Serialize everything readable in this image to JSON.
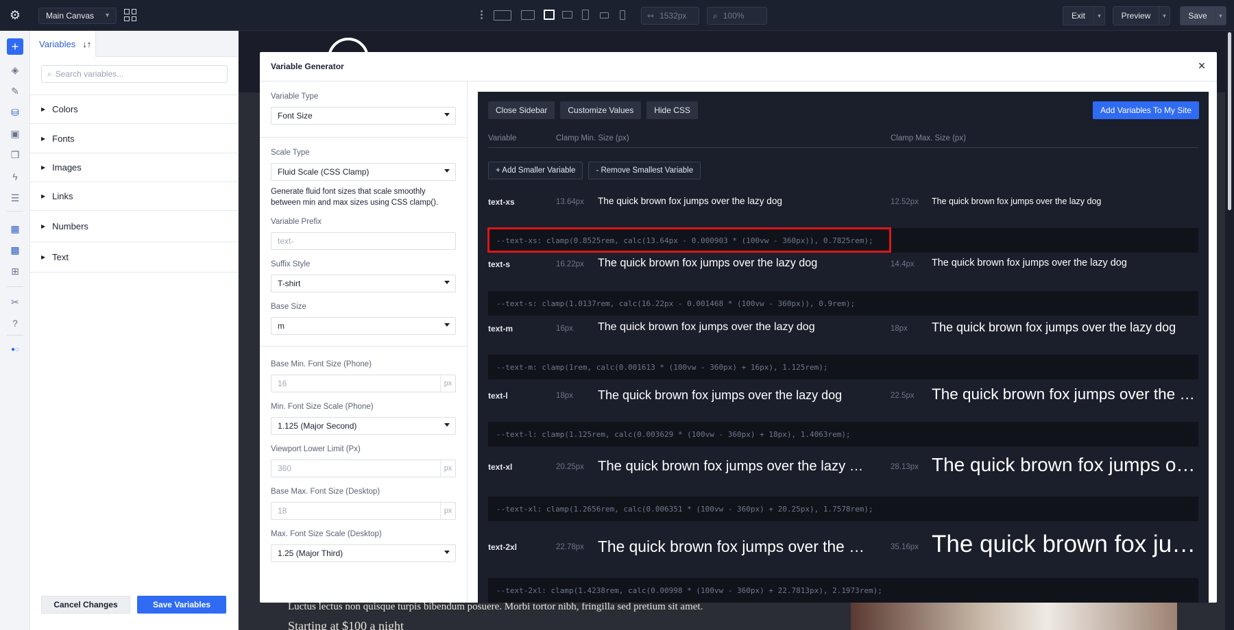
{
  "topbar": {
    "canvas_select": "Main Canvas",
    "width_value": "1532px",
    "zoom_value": "100%",
    "exit_label": "Exit",
    "preview_label": "Preview",
    "save_label": "Save"
  },
  "variables_panel": {
    "tab_label": "Variables",
    "search_placeholder": "Search variables...",
    "groups": [
      "Colors",
      "Fonts",
      "Images",
      "Links",
      "Numbers",
      "Text"
    ],
    "cancel_label": "Cancel Changes",
    "save_label": "Save Variables"
  },
  "canvas": {
    "body_text": "Luctus lectus non quisque turpis bibendum posuere. Morbi tortor nibh, fringilla sed pretium sit amet.",
    "body_text2": "Starting at $100 a night"
  },
  "modal": {
    "title": "Variable Generator",
    "form": {
      "variable_type_label": "Variable Type",
      "variable_type_value": "Font Size",
      "scale_type_label": "Scale Type",
      "scale_type_value": "Fluid Scale (CSS Clamp)",
      "scale_help": "Generate fluid font sizes that scale smoothly between min and max sizes using CSS clamp().",
      "prefix_label": "Variable Prefix",
      "prefix_placeholder": "text-",
      "suffix_label": "Suffix Style",
      "suffix_value": "T-shirt",
      "base_size_label": "Base Size",
      "base_size_value": "m",
      "base_min_label": "Base Min. Font Size (Phone)",
      "base_min_value": "16",
      "min_scale_label": "Min. Font Size Scale (Phone)",
      "min_scale_value": "1.125 (Major Second)",
      "vp_lower_label": "Viewport Lower Limit (Px)",
      "vp_lower_value": "360",
      "base_max_label": "Base Max. Font Size (Desktop)",
      "base_max_value": "18",
      "max_scale_label": "Max. Font Size Scale (Desktop)",
      "max_scale_value": "1.25 (Major Third)",
      "unit": "px"
    },
    "preview": {
      "close_sidebar": "Close Sidebar",
      "customize_values": "Customize Values",
      "hide_css": "Hide CSS",
      "add_to_site": "Add Variables To My Site",
      "col_variable": "Variable",
      "col_min": "Clamp Min. Size (px)",
      "col_max": "Clamp Max. Size (px)",
      "add_smaller": "+ Add Smaller Variable",
      "remove_smallest": "- Remove Smallest Variable",
      "sample_text": "The quick brown fox jumps over the lazy dog",
      "rows": [
        {
          "name": "text-xs",
          "min": "13.64px",
          "max": "12.52px",
          "css": "--text-xs: clamp(0.8525rem, calc(13.64px - 0.000903 * (100vw - 360px)), 0.7825rem);"
        },
        {
          "name": "text-s",
          "min": "16.22px",
          "max": "14.4px",
          "css": "--text-s: clamp(1.0137rem, calc(16.22px - 0.001468 * (100vw - 360px)), 0.9rem);"
        },
        {
          "name": "text-m",
          "min": "16px",
          "max": "18px",
          "css": "--text-m: clamp(1rem, calc(0.001613 * (100vw - 360px) + 16px), 1.125rem);"
        },
        {
          "name": "text-l",
          "min": "18px",
          "max": "22.5px",
          "css": "--text-l: clamp(1.125rem, calc(0.003629 * (100vw - 360px) + 18px), 1.4063rem);"
        },
        {
          "name": "text-xl",
          "min": "20.25px",
          "max": "28.13px",
          "css": "--text-xl: clamp(1.2656rem, calc(0.006351 * (100vw - 360px) + 20.25px), 1.7578rem);"
        },
        {
          "name": "text-2xl",
          "min": "22.78px",
          "max": "35.16px",
          "css": "--text-2xl: clamp(1.4238rem, calc(0.00998 * (100vw - 360px) + 22.7813px), 2.1973rem);"
        }
      ]
    }
  }
}
